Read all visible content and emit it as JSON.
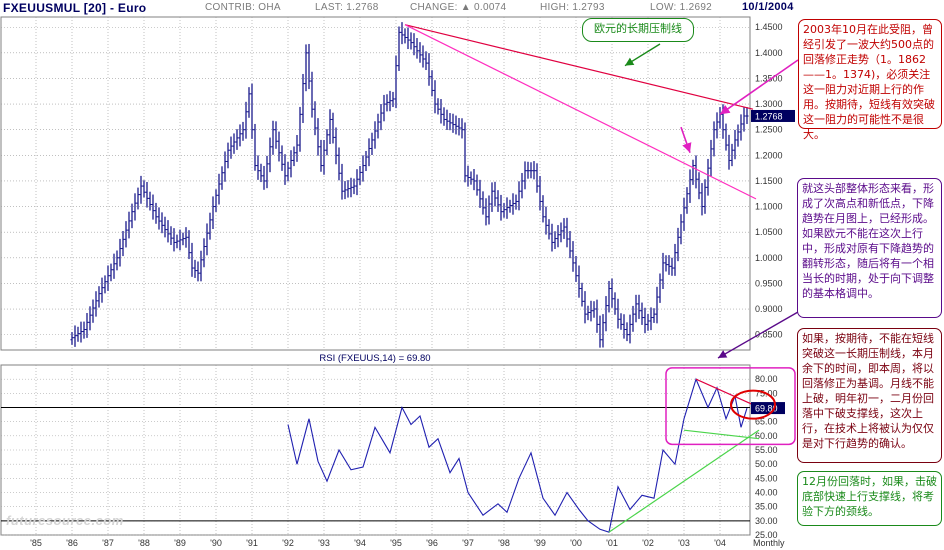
{
  "header": {
    "symbol": "FXEUUSMUL [20] - Euro",
    "contrib": "CONTRIB: OHA",
    "last": "LAST: 1.2768",
    "change": "CHANGE: ▲ 0.0074",
    "high": "HIGH: 1.2793",
    "low": "LOW: 1.2692",
    "date": "10/1/2004"
  },
  "watermark": "futuresource.com",
  "chart_data": [
    {
      "type": "candlestick",
      "frequency": "Monthly",
      "y_axis_side": "right",
      "ylim": [
        0.82,
        1.47
      ],
      "y_ticks": [
        "1.4500",
        "1.4000",
        "1.3500",
        "1.3000",
        "1.2500",
        "1.2000",
        "1.1500",
        "1.1000",
        "1.0500",
        "1.0000",
        "0.9500",
        "0.9000",
        "0.8500"
      ],
      "x_ticks": [
        "'85",
        "'86",
        "'87",
        "'88",
        "'89",
        "'90",
        "'91",
        "'92",
        "'93",
        "'94",
        "'95",
        "'96",
        "'97",
        "'98",
        "'99",
        "'00",
        "'01",
        "'02",
        "'03",
        "'04",
        "Monthly"
      ],
      "last_value_label": "1.2768",
      "series_path": [
        [
          "1986-01",
          0.84
        ],
        [
          "1986-06",
          0.86
        ],
        [
          "1986-11",
          0.93
        ],
        [
          "1987-05",
          1.0
        ],
        [
          "1987-10",
          1.09
        ],
        [
          "1988-01",
          1.14
        ],
        [
          "1988-06",
          1.08
        ],
        [
          "1988-12",
          1.03
        ],
        [
          "1989-04",
          1.04
        ],
        [
          "1989-06",
          0.98
        ],
        [
          "1989-08",
          0.97
        ],
        [
          "1990-01",
          1.1
        ],
        [
          "1990-06",
          1.21
        ],
        [
          "1990-11",
          1.25
        ],
        [
          "1991-01",
          1.32
        ],
        [
          "1991-03",
          1.18
        ],
        [
          "1991-06",
          1.15
        ],
        [
          "1991-09",
          1.25
        ],
        [
          "1992-01",
          1.16
        ],
        [
          "1992-05",
          1.22
        ],
        [
          "1992-08",
          1.4
        ],
        [
          "1992-10",
          1.29
        ],
        [
          "1993-01",
          1.18
        ],
        [
          "1993-04",
          1.27
        ],
        [
          "1993-08",
          1.13
        ],
        [
          "1993-12",
          1.14
        ],
        [
          "1994-03",
          1.18
        ],
        [
          "1994-06",
          1.23
        ],
        [
          "1994-10",
          1.3
        ],
        [
          "1995-01",
          1.31
        ],
        [
          "1995-03",
          1.44
        ],
        [
          "1995-07",
          1.42
        ],
        [
          "1995-12",
          1.38
        ],
        [
          "1996-03",
          1.3
        ],
        [
          "1996-06",
          1.27
        ],
        [
          "1996-12",
          1.25
        ],
        [
          "1997-01",
          1.16
        ],
        [
          "1997-04",
          1.15
        ],
        [
          "1997-08",
          1.08
        ],
        [
          "1997-10",
          1.13
        ],
        [
          "1998-01",
          1.09
        ],
        [
          "1998-06",
          1.11
        ],
        [
          "1998-09",
          1.17
        ],
        [
          "1998-12",
          1.17
        ],
        [
          "1999-03",
          1.08
        ],
        [
          "1999-06",
          1.03
        ],
        [
          "1999-10",
          1.06
        ],
        [
          "2000-01",
          0.99
        ],
        [
          "2000-05",
          0.89
        ],
        [
          "2000-08",
          0.9
        ],
        [
          "2000-10",
          0.84
        ],
        [
          "2001-01",
          0.94
        ],
        [
          "2001-04",
          0.88
        ],
        [
          "2001-07",
          0.85
        ],
        [
          "2001-10",
          0.91
        ],
        [
          "2002-01",
          0.87
        ],
        [
          "2002-04",
          0.89
        ],
        [
          "2002-07",
          0.99
        ],
        [
          "2002-10",
          0.98
        ],
        [
          "2003-01",
          1.07
        ],
        [
          "2003-05",
          1.18
        ],
        [
          "2003-08",
          1.1
        ],
        [
          "2003-12",
          1.25
        ],
        [
          "2004-02",
          1.28
        ],
        [
          "2004-05",
          1.19
        ],
        [
          "2004-07",
          1.23
        ],
        [
          "2004-10",
          1.2768
        ]
      ],
      "trendlines": [
        {
          "name": "long-term-resistance",
          "color": "#e00040",
          "from": [
            "1995-04",
            1.455
          ],
          "to": [
            "2004-12",
            1.29
          ]
        },
        {
          "name": "secondary-resistance",
          "color": "#ff2fbf",
          "from": [
            "1995-04",
            1.455
          ],
          "to": [
            "2005-01",
            1.115
          ]
        }
      ]
    },
    {
      "type": "line",
      "title": "RSI (FXEUUS,14) = 69.80",
      "series": [
        {
          "name": "RSI (FXEUUS,14)",
          "color": "#2020b0"
        }
      ],
      "y_axis_side": "right",
      "ylim": [
        25,
        85
      ],
      "y_ticks": [
        "80.00",
        "75.00",
        "70.00",
        "65.00",
        "60.00",
        "55.00",
        "50.00",
        "45.00",
        "40.00",
        "35.00",
        "30.00",
        "25.00"
      ],
      "reference_lines": [
        70,
        30
      ],
      "last_value_label": "69.80",
      "series_path": [
        [
          "1992-01",
          64
        ],
        [
          "1992-04",
          50
        ],
        [
          "1992-08",
          66
        ],
        [
          "1992-11",
          51
        ],
        [
          "1993-02",
          44
        ],
        [
          "1993-06",
          55
        ],
        [
          "1993-10",
          48
        ],
        [
          "1994-02",
          49
        ],
        [
          "1994-06",
          63
        ],
        [
          "1994-11",
          54
        ],
        [
          "1995-03",
          70
        ],
        [
          "1995-06",
          64
        ],
        [
          "1995-09",
          67
        ],
        [
          "1995-12",
          56
        ],
        [
          "1996-03",
          59
        ],
        [
          "1996-07",
          47
        ],
        [
          "1996-10",
          52
        ],
        [
          "1997-01",
          40
        ],
        [
          "1997-06",
          32
        ],
        [
          "1997-11",
          36
        ],
        [
          "1998-02",
          33
        ],
        [
          "1998-06",
          45
        ],
        [
          "1998-10",
          54
        ],
        [
          "1999-02",
          38
        ],
        [
          "1999-06",
          32
        ],
        [
          "1999-10",
          40
        ],
        [
          "2000-02",
          34
        ],
        [
          "2000-05",
          30
        ],
        [
          "2000-09",
          27
        ],
        [
          "2000-12",
          26
        ],
        [
          "2001-03",
          42
        ],
        [
          "2001-07",
          34
        ],
        [
          "2001-11",
          39
        ],
        [
          "2002-03",
          38
        ],
        [
          "2002-06",
          55
        ],
        [
          "2002-10",
          50
        ],
        [
          "2003-01",
          66
        ],
        [
          "2003-05",
          80
        ],
        [
          "2003-09",
          70
        ],
        [
          "2003-12",
          77
        ],
        [
          "2004-03",
          66
        ],
        [
          "2004-06",
          74
        ],
        [
          "2004-08",
          63
        ],
        [
          "2004-10",
          69.8
        ]
      ],
      "trendlines": [
        {
          "name": "rsi-support-steep",
          "color": "#4ad44a",
          "from": [
            "2000-12",
            26
          ],
          "to": [
            "2005-02",
            62
          ]
        },
        {
          "name": "rsi-support-flat",
          "color": "#4ad44a",
          "from": [
            "2003-01",
            62
          ],
          "to": [
            "2005-02",
            59
          ]
        },
        {
          "name": "rsi-resistance",
          "color": "#e00040",
          "from": [
            "2003-05",
            80
          ],
          "to": [
            "2004-12",
            71
          ]
        }
      ]
    }
  ],
  "annotations": {
    "label_trendline": "欧元的长期压制线",
    "note_top_right": "2003年10月在此受阻，曾经引发了一波大约500点的回落修正走势（1。1862——1。1374)，必须关注这一阻力对近期上行的作用。按期待，短线有效突破这一阻力的可能性不是很大。",
    "note_middle": "就这头部整体形态来看，形成了次高点和新低点，下降趋势在月图上，已经形成。如果欧元不能在这次上行中，形成对原有下降趋势的翻转形态，随后将有一个相当长的时期，处于向下调整的基本格调中。",
    "note_lower": "如果，按期待，不能在短线突破这一长期压制线，本月余下的时间，即本周，将以回落修正为基调。月线不能上破，明年初一，二月份回落中下破支撑线，这次上行，在技术上将被认为仅仅是对下行趋势的确认。",
    "note_bottom": "12月份回落时，如果，击破底部快速上行支撑线，将考验下方的颈线。"
  },
  "colors": {
    "candles": "#1a1a8c",
    "rsi": "#2020b0",
    "grid": "#9a9a9a",
    "red_note": "#c00000",
    "purple_note": "#5a0a8a",
    "maroon_note": "#7a0010",
    "green_note": "#1a8a1a",
    "magenta": "#e020c0",
    "last_price_box": "#000060"
  }
}
